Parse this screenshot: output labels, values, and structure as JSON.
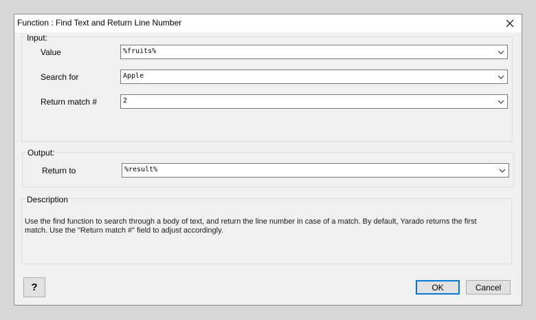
{
  "window": {
    "title": "Function : Find Text and Return Line Number"
  },
  "input_group": {
    "label": "Input:",
    "fields": [
      {
        "label": "Value",
        "value": "%fruits%"
      },
      {
        "label": "Search for",
        "value": "Apple"
      },
      {
        "label": "Return match #",
        "value": "2"
      }
    ]
  },
  "output_group": {
    "label": "Output:",
    "fields": [
      {
        "label": "Return to",
        "value": "%result%"
      }
    ]
  },
  "description": {
    "label": "Description",
    "text": "Use the find function to search through a body of text, and return the line number in case of a match. By default, Yarado returns the first match. Use the \"Return match #\" field to adjust accordingly."
  },
  "buttons": {
    "help": "?",
    "ok": "OK",
    "cancel": "Cancel"
  },
  "icons": {
    "close": "close-icon",
    "dropdown": "chevron-down-icon"
  }
}
